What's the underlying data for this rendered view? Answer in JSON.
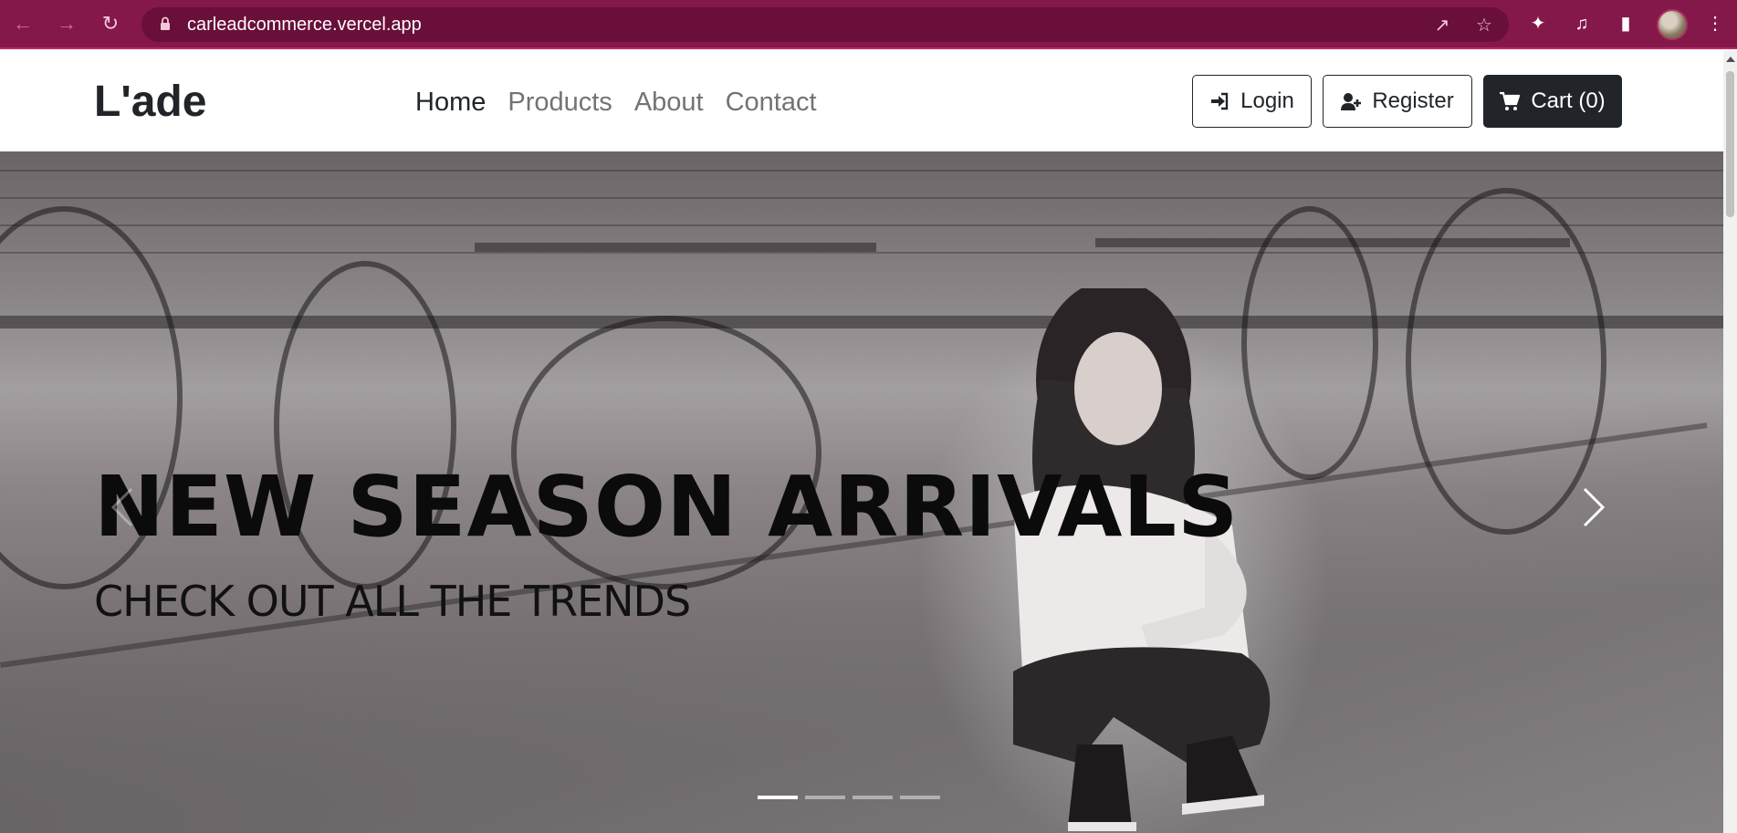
{
  "browser": {
    "url": "carleadcommerce.vercel.app",
    "back_icon": "arrow-left-icon",
    "forward_icon": "arrow-right-icon",
    "reload_icon": "reload-icon"
  },
  "site": {
    "brand": "L'ade",
    "nav": [
      {
        "label": "Home",
        "active": true
      },
      {
        "label": "Products",
        "active": false
      },
      {
        "label": "About",
        "active": false
      },
      {
        "label": "Contact",
        "active": false
      }
    ],
    "login_label": "Login",
    "register_label": "Register",
    "cart_label": "Cart (0)"
  },
  "hero": {
    "title": "NEW SEASON ARRIVALS",
    "subtitle": "CHECK OUT ALL THE TRENDS",
    "slides": 4,
    "active_slide": 1
  },
  "colors": {
    "chrome": "#84184a",
    "omnibox": "#6a0f3a",
    "button_dark": "#212529"
  }
}
